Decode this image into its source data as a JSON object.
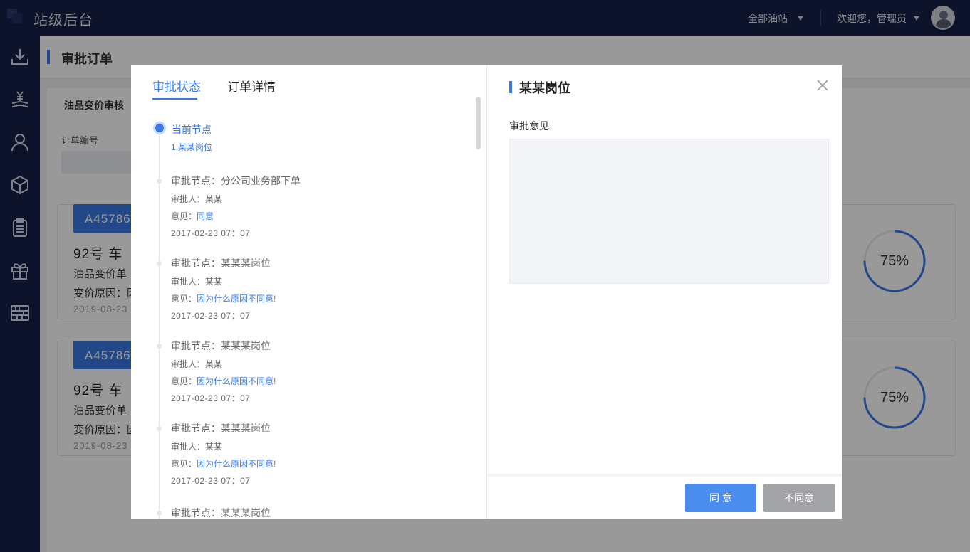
{
  "header": {
    "app_title": "站级后台",
    "station_select": "全部油站",
    "user_greeting": "欢迎您，管理员"
  },
  "sidebar": {
    "items": [
      {
        "icon": "download-icon"
      },
      {
        "icon": "yen-hand-icon"
      },
      {
        "icon": "user-icon"
      },
      {
        "icon": "box-icon"
      },
      {
        "icon": "clipboard-icon"
      },
      {
        "icon": "gift-icon"
      },
      {
        "icon": "abacus-icon"
      }
    ]
  },
  "page": {
    "title": "审批订单",
    "panel_tab": "油品变价审核",
    "order_no_label": "订单编号",
    "cards": [
      {
        "code": "A45786",
        "fuel": "92号  车",
        "line1": "油品变价单",
        "line2": "变价原因：因",
        "date": "2019-08-23",
        "progress_text": "75%",
        "progress": 0.75
      },
      {
        "code": "A45786",
        "fuel": "92号  车",
        "line1": "油品变价单",
        "line2": "变价原因：因",
        "date": "2019-08-23",
        "progress_text": "75%",
        "progress": 0.75
      }
    ]
  },
  "modal": {
    "tabs": [
      {
        "label": "审批状态",
        "active": true
      },
      {
        "label": "订单详情",
        "active": false
      }
    ],
    "current_node": {
      "title": "当前节点",
      "subtitle": "1.某某岗位"
    },
    "nodes": [
      {
        "title": "审批节点：分公司业务部下单",
        "approver": "审批人：某某",
        "opinion_label": "意见：",
        "opinion": "同意",
        "time": "2017-02-23   07：07"
      },
      {
        "title": "审批节点：某某某岗位",
        "approver": "审批人：某某",
        "opinion_label": "意见：",
        "opinion": "因为什么原因不同意!",
        "time": "2017-02-23   07：07"
      },
      {
        "title": "审批节点：某某某岗位",
        "approver": "审批人：某某",
        "opinion_label": "意见：",
        "opinion": "因为什么原因不同意!",
        "time": "2017-02-23   07：07"
      },
      {
        "title": "审批节点：某某某岗位",
        "approver": "审批人：某某",
        "opinion_label": "意见：",
        "opinion": "因为什么原因不同意!",
        "time": "2017-02-23   07：07"
      },
      {
        "title": "审批节点：某某某岗位",
        "approver": "",
        "opinion_label": "",
        "opinion": "",
        "time": ""
      }
    ],
    "right": {
      "title": "某某岗位",
      "opinion_label": "审批意见",
      "opinion_value": "",
      "agree_label": "同 意",
      "disagree_label": "不同意"
    }
  },
  "colors": {
    "accent": "#3b78e7",
    "header_bg": "#172146",
    "disagree_bg": "#a3a4a8"
  }
}
